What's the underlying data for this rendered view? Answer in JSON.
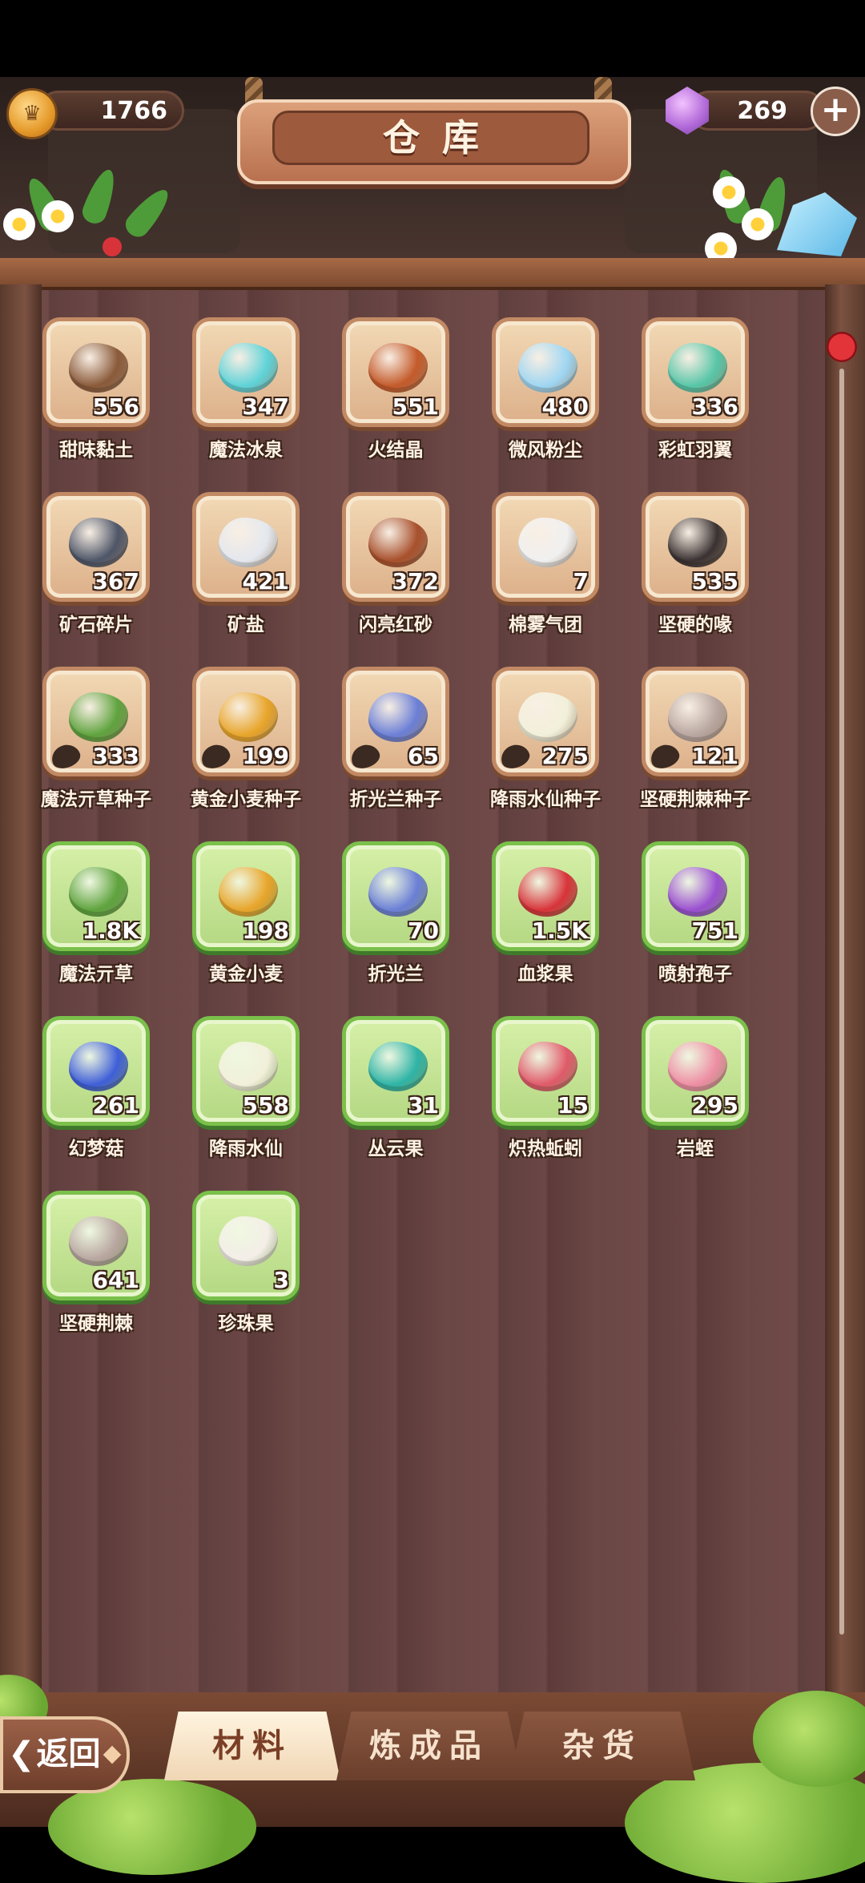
{
  "header": {
    "title": "仓库",
    "coins": "1766",
    "gems": "269"
  },
  "items": [
    {
      "name": "甜味黏土",
      "count": "556",
      "frame": "brown",
      "icon": "clay-icon",
      "color": "#8a5a3a"
    },
    {
      "name": "魔法冰泉",
      "count": "347",
      "frame": "brown",
      "icon": "ice-spring-icon",
      "color": "#5fd3d8"
    },
    {
      "name": "火结晶",
      "count": "551",
      "frame": "brown",
      "icon": "fire-crystal-icon",
      "color": "#c45a2a"
    },
    {
      "name": "微风粉尘",
      "count": "480",
      "frame": "brown",
      "icon": "breeze-dust-icon",
      "color": "#9fd6f2"
    },
    {
      "name": "彩虹羽翼",
      "count": "336",
      "frame": "brown",
      "icon": "rainbow-feather-icon",
      "color": "#58c6a8"
    },
    {
      "name": "矿石碎片",
      "count": "367",
      "frame": "brown",
      "icon": "ore-shard-icon",
      "color": "#4e5668"
    },
    {
      "name": "矿盐",
      "count": "421",
      "frame": "brown",
      "icon": "mineral-salt-icon",
      "color": "#e4e8ee"
    },
    {
      "name": "闪亮红砂",
      "count": "372",
      "frame": "brown",
      "icon": "red-sand-icon",
      "color": "#a8502c"
    },
    {
      "name": "棉雾气团",
      "count": "7",
      "frame": "brown",
      "icon": "cotton-mist-icon",
      "color": "#f0f0f0"
    },
    {
      "name": "坚硬的喙",
      "count": "535",
      "frame": "brown",
      "icon": "hard-beak-icon",
      "color": "#3a3232"
    },
    {
      "name": "魔法亓草种子",
      "count": "333",
      "frame": "brown",
      "icon": "magic-herb-seed-icon",
      "color": "#5fa33e",
      "seed": true
    },
    {
      "name": "黄金小麦种子",
      "count": "199",
      "frame": "brown",
      "icon": "golden-wheat-seed-icon",
      "color": "#e8a52a",
      "seed": true
    },
    {
      "name": "折光兰种子",
      "count": "65",
      "frame": "brown",
      "icon": "prism-orchid-seed-icon",
      "color": "#6b7fd6",
      "seed": true
    },
    {
      "name": "降雨水仙种子",
      "count": "275",
      "frame": "brown",
      "icon": "rain-narcissus-seed-icon",
      "color": "#f2f0da",
      "seed": true
    },
    {
      "name": "坚硬荆棘种子",
      "count": "121",
      "frame": "brown",
      "icon": "hard-thorn-seed-icon",
      "color": "#b8a6a0",
      "seed": true
    },
    {
      "name": "魔法亓草",
      "count": "1.8K",
      "frame": "green",
      "icon": "magic-herb-icon",
      "color": "#5fa33e"
    },
    {
      "name": "黄金小麦",
      "count": "198",
      "frame": "green",
      "icon": "golden-wheat-icon",
      "color": "#e8a52a"
    },
    {
      "name": "折光兰",
      "count": "70",
      "frame": "green",
      "icon": "prism-orchid-icon",
      "color": "#6b7fd6"
    },
    {
      "name": "血浆果",
      "count": "1.5K",
      "frame": "green",
      "icon": "blood-berry-icon",
      "color": "#d8333a"
    },
    {
      "name": "喷射孢子",
      "count": "751",
      "frame": "green",
      "icon": "spray-spore-icon",
      "color": "#9a4fd0"
    },
    {
      "name": "幻梦菇",
      "count": "261",
      "frame": "green",
      "icon": "dream-mushroom-icon",
      "color": "#3f5fd8"
    },
    {
      "name": "降雨水仙",
      "count": "558",
      "frame": "green",
      "icon": "rain-narcissus-icon",
      "color": "#f2f0da"
    },
    {
      "name": "丛云果",
      "count": "31",
      "frame": "green",
      "icon": "cloud-fruit-icon",
      "color": "#2fb4a6"
    },
    {
      "name": "炽热蚯蚓",
      "count": "15",
      "frame": "green",
      "icon": "blazing-worm-icon",
      "color": "#e05a6a"
    },
    {
      "name": "岩蛭",
      "count": "295",
      "frame": "green",
      "icon": "rock-leech-icon",
      "color": "#ee8ea4"
    },
    {
      "name": "坚硬荆棘",
      "count": "641",
      "frame": "green",
      "icon": "hard-thorn-icon",
      "color": "#b8a6a0"
    },
    {
      "name": "珍珠果",
      "count": "3",
      "frame": "green",
      "icon": "pearl-fruit-icon",
      "color": "#f4eee8"
    }
  ],
  "tabs": [
    {
      "label": "材料",
      "active": true
    },
    {
      "label": "炼成品",
      "active": false
    },
    {
      "label": "杂货",
      "active": false
    }
  ],
  "back": {
    "label": "返回"
  }
}
